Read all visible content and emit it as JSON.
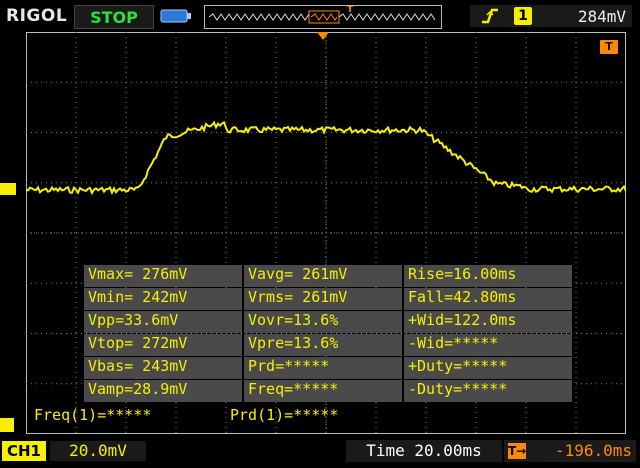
{
  "top": {
    "brand": "RIGOL",
    "run_state": "STOP",
    "trigger_source": "1",
    "trigger_level": "284mV",
    "trigger_edge_icon": "rising-edge-icon"
  },
  "markers": {
    "trigger_level_flag": "T"
  },
  "measurements": [
    [
      "Vmax= 276mV",
      "Vavg= 261mV",
      "Rise=16.00ms"
    ],
    [
      "Vmin= 242mV",
      "Vrms= 261mV",
      "Fall=42.80ms"
    ],
    [
      "Vpp=33.6mV",
      "Vovr=13.6%",
      "+Wid=122.0ms"
    ],
    [
      "Vtop= 272mV",
      "Vpre=13.6%",
      "-Wid=*****"
    ],
    [
      "Vbas= 243mV",
      "Prd=*****",
      "+Duty=*****"
    ],
    [
      "Vamp=28.9mV",
      "Freq=*****",
      "-Duty=*****"
    ]
  ],
  "counters": {
    "freq": "Freq(1)=*****",
    "prd": "Prd(1)=*****"
  },
  "bottom": {
    "channel": "CH1",
    "volts_div": "20.0mV",
    "timebase": "Time 20.00ms",
    "offset": "-196.0ms",
    "offset_icon": "trigger-offset-icon"
  },
  "colors": {
    "trace": "#f6ef00",
    "accent": "#ff8a00",
    "grid": "#7a7a7a"
  }
}
